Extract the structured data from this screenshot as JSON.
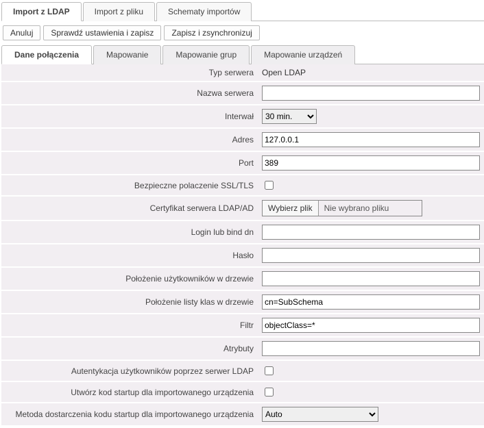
{
  "topTabs": {
    "t0": "Import z LDAP",
    "t1": "Import z pliku",
    "t2": "Schematy importów"
  },
  "buttons": {
    "cancel": "Anuluj",
    "checkSave": "Sprawdź ustawienia i zapisz",
    "saveSync": "Zapisz i zsynchronizuj"
  },
  "innerTabs": {
    "i0": "Dane połączenia",
    "i1": "Mapowanie",
    "i2": "Mapowanie grup",
    "i3": "Mapowanie urządzeń"
  },
  "labels": {
    "serverType": "Typ serwera",
    "serverName": "Nazwa serwera",
    "interval": "Interwał",
    "address": "Adres",
    "port": "Port",
    "ssl": "Bezpieczne polaczenie SSL/TLS",
    "cert": "Certyfikat serwera LDAP/AD",
    "login": "Login lub bind dn",
    "password": "Hasło",
    "usersPos": "Położenie użytkowników w drzewie",
    "classesPos": "Położenie listy klas w drzewie",
    "filter": "Filtr",
    "attributes": "Atrybuty",
    "authLdap": "Autentykacja użytkowników poprzez serwer LDAP",
    "createStartup": "Utwórz kod startup dla importowanego urządzenia",
    "deliveryMethod": "Metoda dostarczenia kodu startup dla importowanego urządzenia"
  },
  "values": {
    "serverType": "Open LDAP",
    "serverName": "",
    "interval": "30 min.",
    "address": "127.0.0.1",
    "port": "389",
    "login": "",
    "password": "",
    "usersPos": "",
    "classesPos": "cn=SubSchema",
    "filter": "objectClass=*",
    "attributes": "",
    "deliveryMethod": "Auto"
  },
  "filePicker": {
    "button": "Wybierz plik",
    "status": "Nie wybrano pliku"
  }
}
